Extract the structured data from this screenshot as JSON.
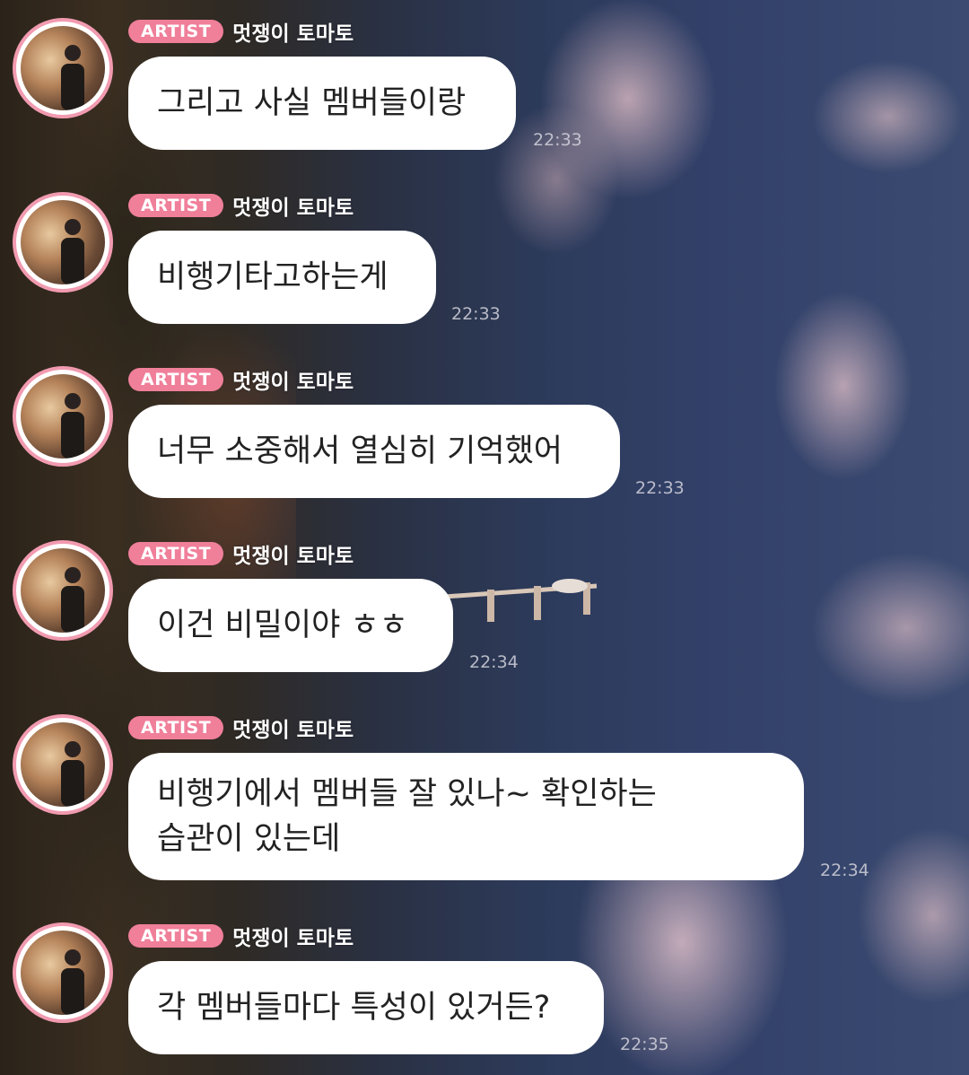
{
  "sender": {
    "badge": "ARTIST",
    "name": "멋쟁이 토마토"
  },
  "messages": [
    {
      "text": "그리고 사실 멤버들이랑",
      "time": "22:33"
    },
    {
      "text": "비행기타고하는게",
      "time": "22:33"
    },
    {
      "text": "너무 소중해서 열심히 기억했어",
      "time": "22:33"
    },
    {
      "text": "이건 비밀이야 ㅎㅎ",
      "time": "22:34"
    },
    {
      "text": "비행기에서 멤버들 잘 있나~ 확인하는\n습관이 있는데",
      "time": "22:34"
    },
    {
      "text": "각 멤버들마다 특성이 있거든?",
      "time": "22:35"
    }
  ],
  "colors": {
    "badge": "#f07f9a",
    "avatar_ring": "#f19ab0",
    "bubble": "#ffffff"
  }
}
